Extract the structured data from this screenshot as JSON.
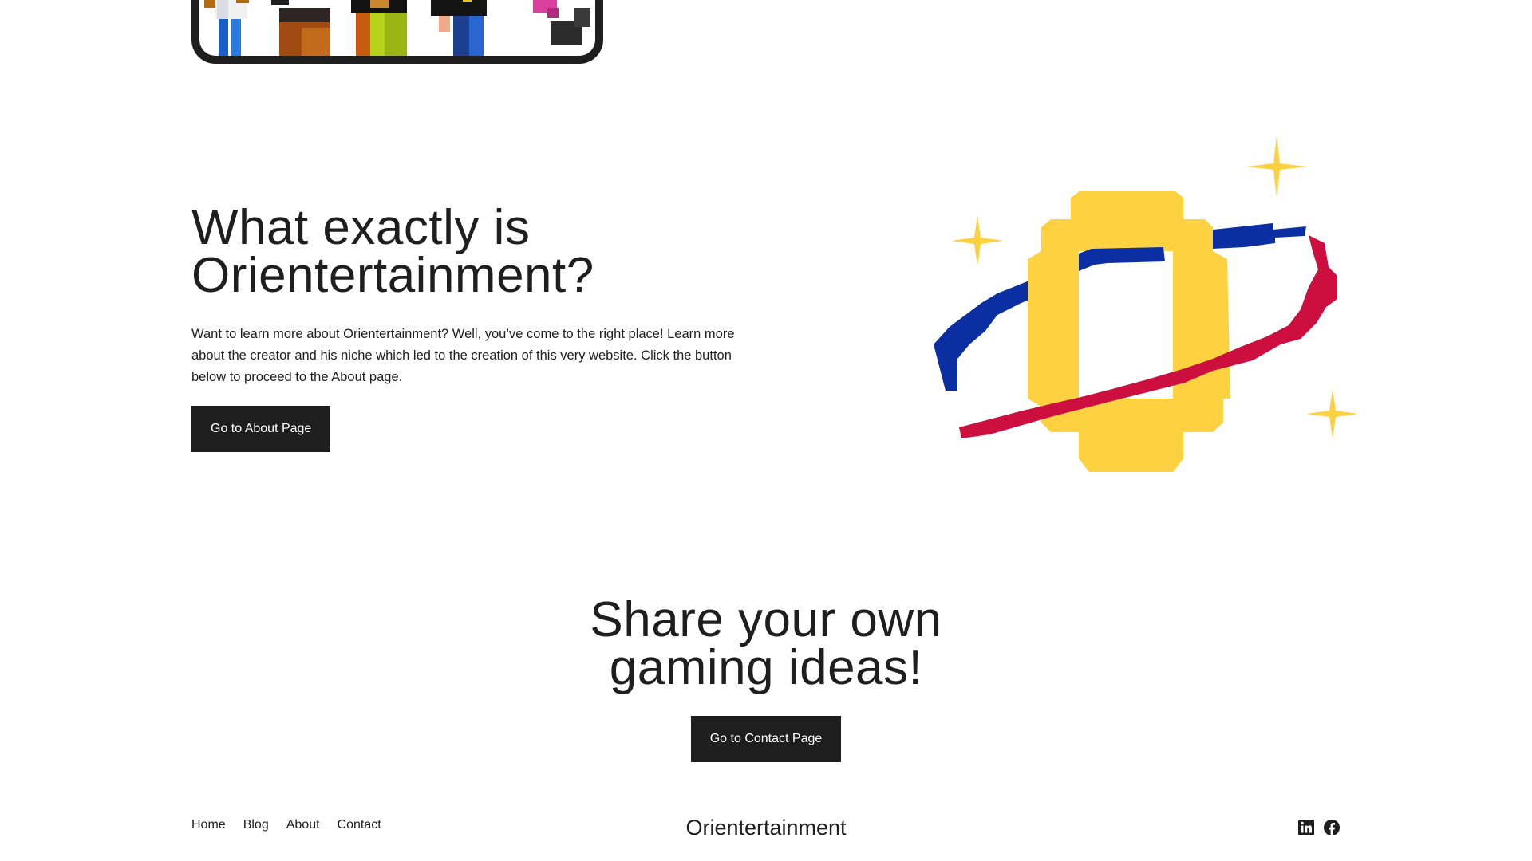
{
  "about": {
    "title_line1": "What exactly is",
    "title_line2": "Orientertainment?",
    "description": "Want to learn more about Orientertainment? Well, you’ve come to the right place! Learn more about the creator and his niche which led to the creation of this very website. Click the button below to proceed to the About page.",
    "button_label": "Go to About Page"
  },
  "share": {
    "title_line1": "Share your own",
    "title_line2": "gaming ideas!",
    "button_label": "Go to Contact Page"
  },
  "footer": {
    "nav": [
      "Home",
      "Blog",
      "About",
      "Contact"
    ],
    "brand": "Orientertainment",
    "social": [
      "linkedin-icon",
      "facebook-icon"
    ]
  },
  "colors": {
    "text": "#1e1e1e",
    "button_bg": "#1e1e1e",
    "button_text": "#ffffff",
    "logo_yellow": "#fdd13f",
    "logo_blue": "#0b2fa3",
    "logo_red": "#cc0f3f"
  }
}
